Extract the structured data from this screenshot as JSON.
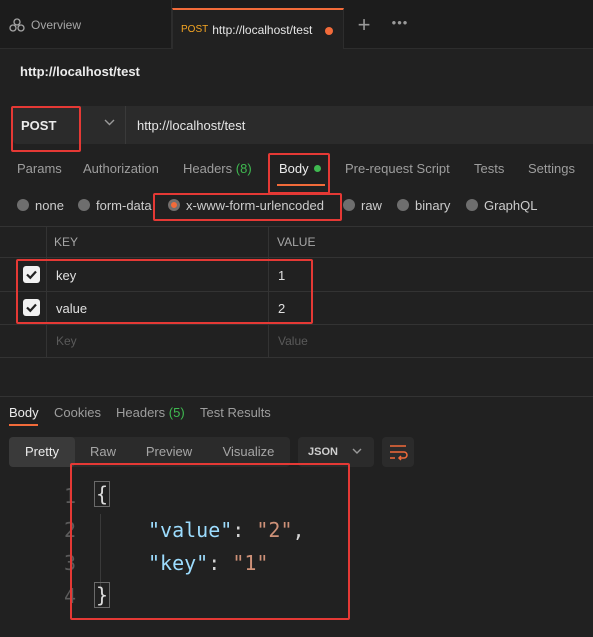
{
  "tabs": {
    "overview_label": "Overview",
    "active_method": "POST",
    "active_url": "http://localhost/test"
  },
  "request": {
    "title": "http://localhost/test",
    "method": "POST",
    "url": "http://localhost/test"
  },
  "request_tabs": {
    "params": "Params",
    "authorization": "Authorization",
    "headers": "Headers",
    "headers_count": "(8)",
    "body": "Body",
    "pre_request": "Pre-request Script",
    "tests": "Tests",
    "settings": "Settings"
  },
  "body_types": {
    "none": "none",
    "form_data": "form-data",
    "urlencoded": "x-www-form-urlencoded",
    "raw": "raw",
    "binary": "binary",
    "graphql": "GraphQL",
    "selected": "x-www-form-urlencoded"
  },
  "params_table": {
    "headers": [
      "KEY",
      "VALUE"
    ],
    "rows": [
      {
        "key": "key",
        "value": "1",
        "checked": true
      },
      {
        "key": "value",
        "value": "2",
        "checked": true
      }
    ],
    "placeholder_key": "Key",
    "placeholder_value": "Value"
  },
  "response": {
    "tabs": {
      "body": "Body",
      "cookies": "Cookies",
      "headers": "Headers",
      "headers_count": "(5)",
      "test_results": "Test Results"
    },
    "view_modes": [
      "Pretty",
      "Raw",
      "Preview",
      "Visualize"
    ],
    "active_view": "Pretty",
    "format": "JSON",
    "code": {
      "line_numbers": [
        "1",
        "2",
        "3",
        "4"
      ],
      "open_brace": "{",
      "close_brace": "}",
      "k1": "\"value\"",
      "v1": "\"2\"",
      "k2": "\"key\"",
      "v2": "\"1\"",
      "colon": ": ",
      "comma": ","
    }
  },
  "colors": {
    "accent": "#f26b3a",
    "annotation": "#e53935",
    "success": "#3fb950"
  }
}
